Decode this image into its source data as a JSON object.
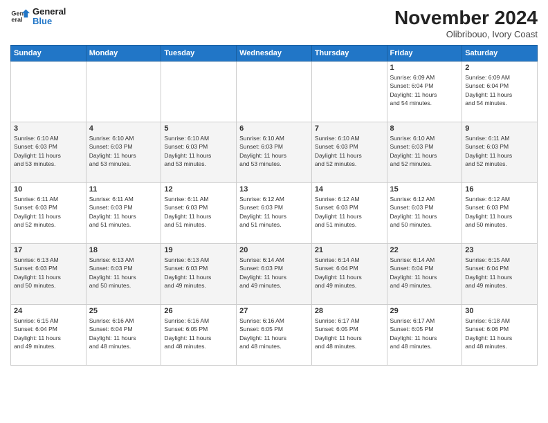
{
  "header": {
    "logo_line1": "General",
    "logo_line2": "Blue",
    "month": "November 2024",
    "location": "Olibribouo, Ivory Coast"
  },
  "weekdays": [
    "Sunday",
    "Monday",
    "Tuesday",
    "Wednesday",
    "Thursday",
    "Friday",
    "Saturday"
  ],
  "weeks": [
    [
      {
        "day": "",
        "info": ""
      },
      {
        "day": "",
        "info": ""
      },
      {
        "day": "",
        "info": ""
      },
      {
        "day": "",
        "info": ""
      },
      {
        "day": "",
        "info": ""
      },
      {
        "day": "1",
        "info": "Sunrise: 6:09 AM\nSunset: 6:04 PM\nDaylight: 11 hours\nand 54 minutes."
      },
      {
        "day": "2",
        "info": "Sunrise: 6:09 AM\nSunset: 6:04 PM\nDaylight: 11 hours\nand 54 minutes."
      }
    ],
    [
      {
        "day": "3",
        "info": "Sunrise: 6:10 AM\nSunset: 6:03 PM\nDaylight: 11 hours\nand 53 minutes."
      },
      {
        "day": "4",
        "info": "Sunrise: 6:10 AM\nSunset: 6:03 PM\nDaylight: 11 hours\nand 53 minutes."
      },
      {
        "day": "5",
        "info": "Sunrise: 6:10 AM\nSunset: 6:03 PM\nDaylight: 11 hours\nand 53 minutes."
      },
      {
        "day": "6",
        "info": "Sunrise: 6:10 AM\nSunset: 6:03 PM\nDaylight: 11 hours\nand 53 minutes."
      },
      {
        "day": "7",
        "info": "Sunrise: 6:10 AM\nSunset: 6:03 PM\nDaylight: 11 hours\nand 52 minutes."
      },
      {
        "day": "8",
        "info": "Sunrise: 6:10 AM\nSunset: 6:03 PM\nDaylight: 11 hours\nand 52 minutes."
      },
      {
        "day": "9",
        "info": "Sunrise: 6:11 AM\nSunset: 6:03 PM\nDaylight: 11 hours\nand 52 minutes."
      }
    ],
    [
      {
        "day": "10",
        "info": "Sunrise: 6:11 AM\nSunset: 6:03 PM\nDaylight: 11 hours\nand 52 minutes."
      },
      {
        "day": "11",
        "info": "Sunrise: 6:11 AM\nSunset: 6:03 PM\nDaylight: 11 hours\nand 51 minutes."
      },
      {
        "day": "12",
        "info": "Sunrise: 6:11 AM\nSunset: 6:03 PM\nDaylight: 11 hours\nand 51 minutes."
      },
      {
        "day": "13",
        "info": "Sunrise: 6:12 AM\nSunset: 6:03 PM\nDaylight: 11 hours\nand 51 minutes."
      },
      {
        "day": "14",
        "info": "Sunrise: 6:12 AM\nSunset: 6:03 PM\nDaylight: 11 hours\nand 51 minutes."
      },
      {
        "day": "15",
        "info": "Sunrise: 6:12 AM\nSunset: 6:03 PM\nDaylight: 11 hours\nand 50 minutes."
      },
      {
        "day": "16",
        "info": "Sunrise: 6:12 AM\nSunset: 6:03 PM\nDaylight: 11 hours\nand 50 minutes."
      }
    ],
    [
      {
        "day": "17",
        "info": "Sunrise: 6:13 AM\nSunset: 6:03 PM\nDaylight: 11 hours\nand 50 minutes."
      },
      {
        "day": "18",
        "info": "Sunrise: 6:13 AM\nSunset: 6:03 PM\nDaylight: 11 hours\nand 50 minutes."
      },
      {
        "day": "19",
        "info": "Sunrise: 6:13 AM\nSunset: 6:03 PM\nDaylight: 11 hours\nand 49 minutes."
      },
      {
        "day": "20",
        "info": "Sunrise: 6:14 AM\nSunset: 6:03 PM\nDaylight: 11 hours\nand 49 minutes."
      },
      {
        "day": "21",
        "info": "Sunrise: 6:14 AM\nSunset: 6:04 PM\nDaylight: 11 hours\nand 49 minutes."
      },
      {
        "day": "22",
        "info": "Sunrise: 6:14 AM\nSunset: 6:04 PM\nDaylight: 11 hours\nand 49 minutes."
      },
      {
        "day": "23",
        "info": "Sunrise: 6:15 AM\nSunset: 6:04 PM\nDaylight: 11 hours\nand 49 minutes."
      }
    ],
    [
      {
        "day": "24",
        "info": "Sunrise: 6:15 AM\nSunset: 6:04 PM\nDaylight: 11 hours\nand 49 minutes."
      },
      {
        "day": "25",
        "info": "Sunrise: 6:16 AM\nSunset: 6:04 PM\nDaylight: 11 hours\nand 48 minutes."
      },
      {
        "day": "26",
        "info": "Sunrise: 6:16 AM\nSunset: 6:05 PM\nDaylight: 11 hours\nand 48 minutes."
      },
      {
        "day": "27",
        "info": "Sunrise: 6:16 AM\nSunset: 6:05 PM\nDaylight: 11 hours\nand 48 minutes."
      },
      {
        "day": "28",
        "info": "Sunrise: 6:17 AM\nSunset: 6:05 PM\nDaylight: 11 hours\nand 48 minutes."
      },
      {
        "day": "29",
        "info": "Sunrise: 6:17 AM\nSunset: 6:05 PM\nDaylight: 11 hours\nand 48 minutes."
      },
      {
        "day": "30",
        "info": "Sunrise: 6:18 AM\nSunset: 6:06 PM\nDaylight: 11 hours\nand 48 minutes."
      }
    ]
  ]
}
